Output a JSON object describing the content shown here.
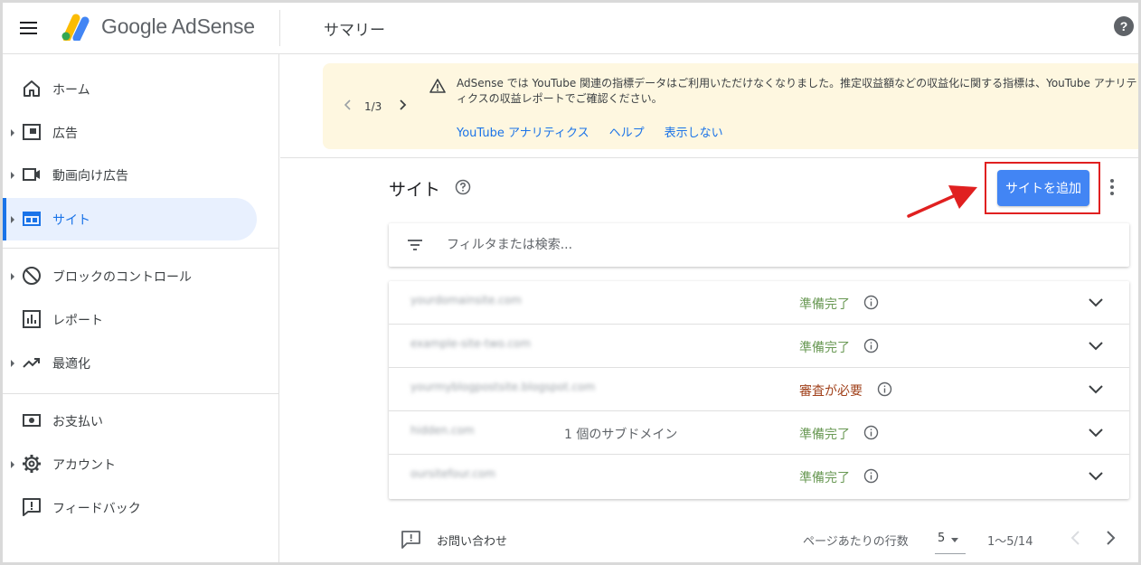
{
  "header": {
    "brand": "Google AdSense",
    "page_title": "サマリー",
    "help": "?"
  },
  "sidebar": {
    "items": [
      {
        "label": "ホーム",
        "icon": "home-icon"
      },
      {
        "label": "広告",
        "icon": "ads-icon"
      },
      {
        "label": "動画向け広告",
        "icon": "video-icon"
      },
      {
        "label": "サイト",
        "icon": "sites-icon"
      },
      {
        "label": "ブロックのコントロール",
        "icon": "block-icon"
      },
      {
        "label": "レポート",
        "icon": "report-icon"
      },
      {
        "label": "最適化",
        "icon": "trending-up-icon"
      },
      {
        "label": "お支払い",
        "icon": "payments-icon"
      },
      {
        "label": "アカウント",
        "icon": "gear-icon"
      },
      {
        "label": "フィードバック",
        "icon": "feedback-icon"
      }
    ],
    "active_item": "サイト"
  },
  "banner": {
    "page": "1/3",
    "message": "AdSense では YouTube 関連の指標データはご利用いただけなくなりました。推定収益額などの収益化に関する指標は、YouTube アナリティクスの収益レポートでご確認ください。",
    "links": [
      "YouTube アナリティクス",
      "ヘルプ",
      "表示しない"
    ]
  },
  "sites": {
    "title": "サイト",
    "add_button": "サイトを追加",
    "filter_placeholder": "フィルタまたは検索...",
    "rows": [
      {
        "name": "yourdomainsite.com",
        "subdomains": "",
        "status": "準備完了",
        "status_color": "#6a9955"
      },
      {
        "name": "example-site-two.com",
        "subdomains": "",
        "status": "準備完了",
        "status_color": "#6a9955"
      },
      {
        "name": "yourmyblogpostsite.blogspot.com",
        "subdomains": "",
        "status": "審査が必要",
        "status_color": "#a0401a"
      },
      {
        "name": "hidden.com",
        "subdomains": "1 個のサブドメイン",
        "status": "準備完了",
        "status_color": "#6a9955"
      },
      {
        "name": "oursitefour.com",
        "subdomains": "",
        "status": "準備完了",
        "status_color": "#6a9955"
      }
    ]
  },
  "footer": {
    "contact": "お問い合わせ",
    "rows_per_page_label": "ページあたりの行数",
    "rows_per_page": "5",
    "range": "1～5/14"
  },
  "colors": {
    "accent": "#1a73e8",
    "button": "#4285f4",
    "banner_bg": "#fef7e0",
    "highlight": "#e02020"
  }
}
